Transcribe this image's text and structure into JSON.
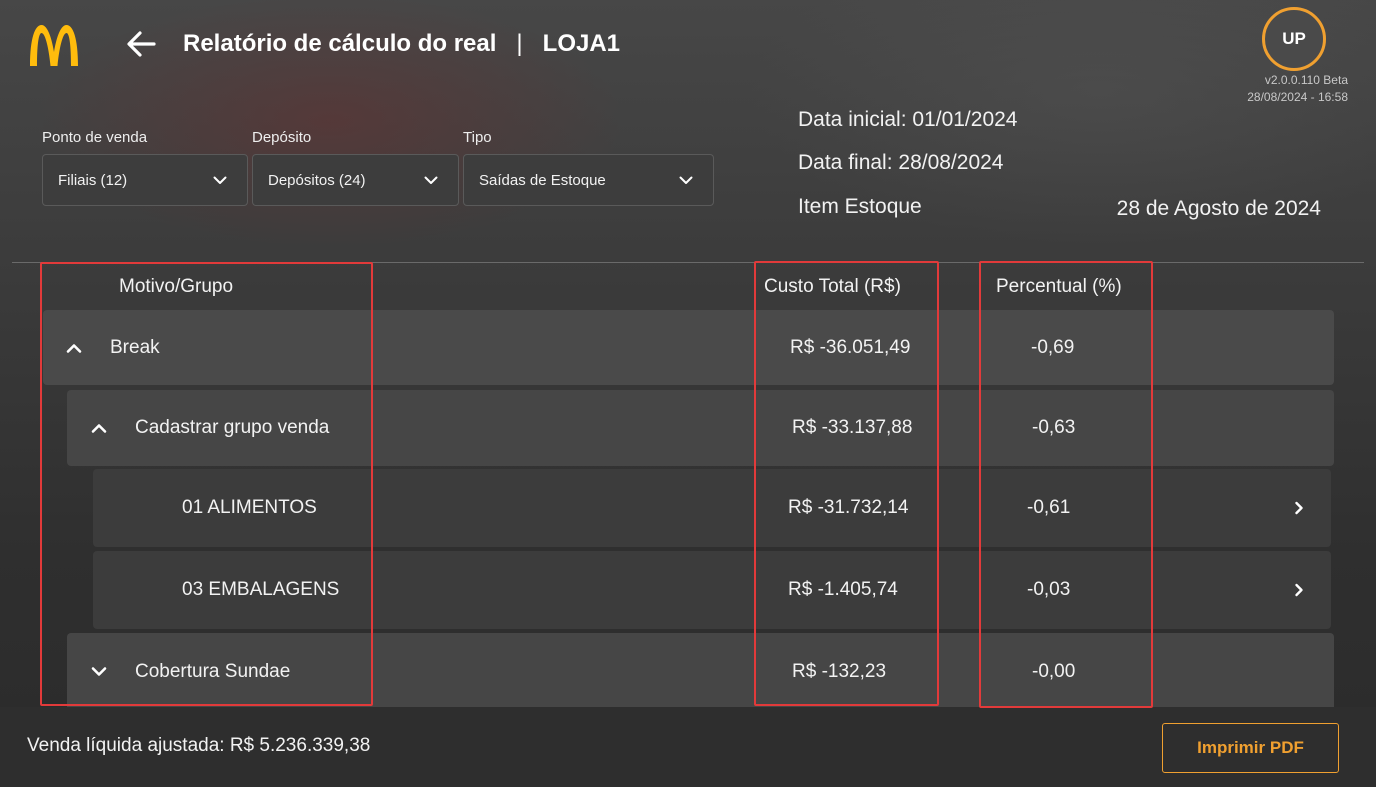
{
  "header": {
    "title": "Relatório de cálculo do real",
    "separator": "|",
    "store": "LOJA1",
    "avatar_initials": "UP",
    "version": "v2.0.0.110 Beta",
    "datetime": "28/08/2024 - 16:58"
  },
  "filters": [
    {
      "label": "Ponto de venda",
      "value": "Filiais (12)"
    },
    {
      "label": "Depósito",
      "value": "Depósitos (24)"
    },
    {
      "label": "Tipo",
      "value": "Saídas de Estoque"
    }
  ],
  "info": {
    "data_inicial": "Data inicial: 01/01/2024",
    "data_final": "Data final: 28/08/2024",
    "item": "Item Estoque",
    "date_long": "28 de Agosto de 2024"
  },
  "table": {
    "columns": [
      "Motivo/Grupo",
      "Custo Total (R$)",
      "Percentual (%)"
    ],
    "rows": [
      {
        "name": "Break",
        "cost": "R$ -36.051,49",
        "percent": "-0,69",
        "level": 1,
        "expanded": true
      },
      {
        "name": "Cadastrar grupo venda",
        "cost": "R$ -33.137,88",
        "percent": "-0,63",
        "level": 2,
        "expanded": true
      },
      {
        "name": "01 ALIMENTOS",
        "cost": "R$ -31.732,14",
        "percent": "-0,61",
        "level": 3
      },
      {
        "name": "03 EMBALAGENS",
        "cost": "R$ -1.405,74",
        "percent": "-0,03",
        "level": 3
      },
      {
        "name": "Cobertura Sundae",
        "cost": "R$ -132,23",
        "percent": "-0,00",
        "level": 2,
        "expanded": false
      }
    ]
  },
  "footer": {
    "net_sales": "Venda líquida ajustada: R$ 5.236.339,38",
    "print_button": "Imprimir PDF"
  },
  "colors": {
    "accent": "#f0a030",
    "logo": "#ffbc0d",
    "highlight": "#e23a3a"
  }
}
